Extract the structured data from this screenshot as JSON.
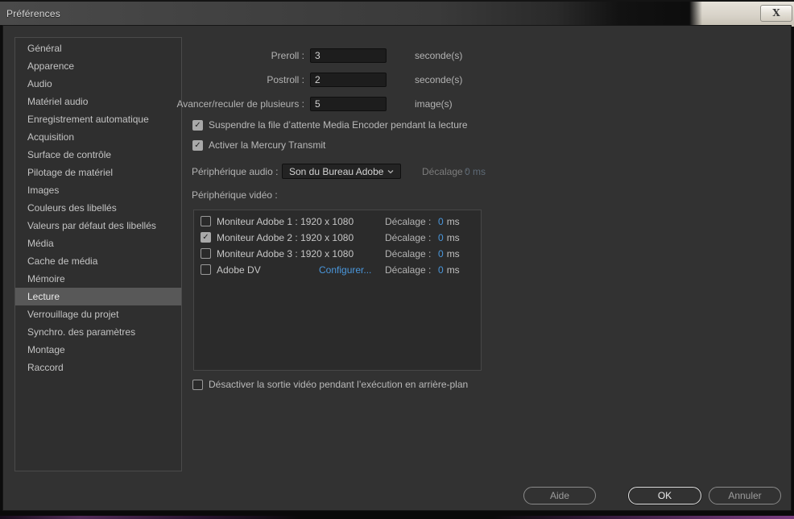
{
  "window": {
    "title": "Préférences",
    "close": "X"
  },
  "colors": {
    "accent_blue": "#4a97dc",
    "dialog_bg": "#323232",
    "selection_bg": "#585858"
  },
  "sidebar": {
    "items": [
      {
        "label": "Général",
        "selected": false
      },
      {
        "label": "Apparence",
        "selected": false
      },
      {
        "label": "Audio",
        "selected": false
      },
      {
        "label": "Matériel audio",
        "selected": false
      },
      {
        "label": "Enregistrement automatique",
        "selected": false
      },
      {
        "label": "Acquisition",
        "selected": false
      },
      {
        "label": "Surface de contrôle",
        "selected": false
      },
      {
        "label": "Pilotage de matériel",
        "selected": false
      },
      {
        "label": "Images",
        "selected": false
      },
      {
        "label": "Couleurs des libellés",
        "selected": false
      },
      {
        "label": "Valeurs par défaut des libellés",
        "selected": false
      },
      {
        "label": "Média",
        "selected": false
      },
      {
        "label": "Cache de média",
        "selected": false
      },
      {
        "label": "Mémoire",
        "selected": false
      },
      {
        "label": "Lecture",
        "selected": true
      },
      {
        "label": "Verrouillage du projet",
        "selected": false
      },
      {
        "label": "Synchro. des paramètres",
        "selected": false
      },
      {
        "label": "Montage",
        "selected": false
      },
      {
        "label": "Raccord",
        "selected": false
      }
    ]
  },
  "form": {
    "fields": {
      "preroll": {
        "label": "Preroll :",
        "value": "3",
        "unit": "seconde(s)"
      },
      "postroll": {
        "label": "Postroll :",
        "value": "2",
        "unit": "seconde(s)"
      },
      "step_many": {
        "label": "Avancer/reculer de plusieurs :",
        "value": "5",
        "unit": "image(s)"
      }
    },
    "checkboxes": {
      "suspend_queue": {
        "label": "Suspendre la file d’attente Media Encoder pendant la lecture",
        "check": "✓"
      },
      "mercury_transmit": {
        "label": "Activer la Mercury Transmit",
        "check": "✓"
      },
      "disable_bg_video": {
        "label": "Désactiver la sortie vidéo pendant l’exécution en arrière-plan",
        "check": ""
      }
    },
    "audio_device": {
      "label": "Périphérique audio :",
      "selected": "Son du Bureau Adobe",
      "offset_label": "Décalage :",
      "offset_value": "0 ms"
    },
    "video_section_label": "Périphérique vidéo :",
    "video_devices": [
      {
        "name": "Moniteur Adobe 1 : 1920 x 1080",
        "check": "",
        "configure": "",
        "offset_label": "Décalage :",
        "offset_value": "0",
        "offset_unit": "ms"
      },
      {
        "name": "Moniteur Adobe 2 : 1920 x 1080",
        "check": "✓",
        "configure": "",
        "offset_label": "Décalage :",
        "offset_value": "0",
        "offset_unit": "ms"
      },
      {
        "name": "Moniteur Adobe 3 : 1920 x 1080",
        "check": "",
        "configure": "",
        "offset_label": "Décalage :",
        "offset_value": "0",
        "offset_unit": "ms"
      },
      {
        "name": "Adobe DV",
        "check": "",
        "configure": "Configurer...",
        "offset_label": "Décalage :",
        "offset_value": "0",
        "offset_unit": "ms"
      }
    ]
  },
  "buttons": {
    "help": "Aide",
    "ok": "OK",
    "cancel": "Annuler"
  }
}
